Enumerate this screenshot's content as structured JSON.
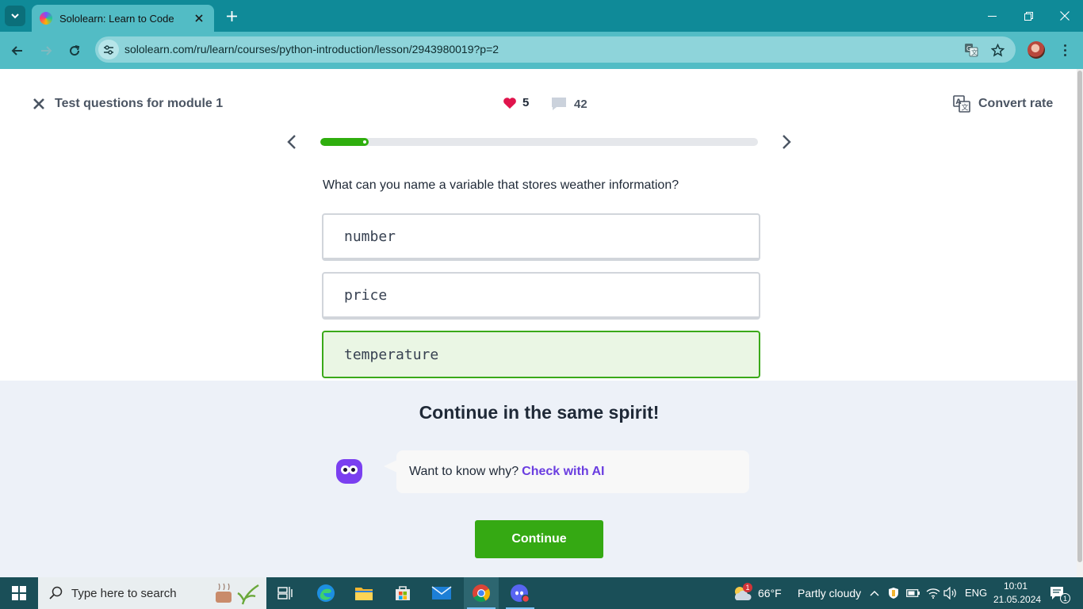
{
  "browser": {
    "tab_title": "Sololearn: Learn to Code",
    "url": "sololearn.com/ru/learn/courses/python-introduction/lesson/2943980019?p=2"
  },
  "lesson": {
    "title": "Test questions for module 1",
    "hearts": "5",
    "comments": "42",
    "convert_label": "Convert rate",
    "progress": 0.11
  },
  "quiz": {
    "question": "What can you name a variable that stores weather information?",
    "options": [
      {
        "text": "number",
        "state": "default"
      },
      {
        "text": "price",
        "state": "default"
      },
      {
        "text": "temperature",
        "state": "correct"
      }
    ]
  },
  "feedback": {
    "title": "Continue in the same spirit!",
    "ai_prompt": "Want to know why?",
    "ai_link": "Check with AI",
    "continue_label": "Continue"
  },
  "taskbar": {
    "search_placeholder": "Type here to search",
    "weather_temp": "66°F",
    "weather_desc": "Partly cloudy",
    "weather_badge": "1",
    "language": "ENG",
    "time": "10:01",
    "date": "21.05.2024",
    "notification_count": "1"
  },
  "colors": {
    "tab_strip": "#0f8a98",
    "toolbar": "#52bcc5",
    "accent_green": "#35a913",
    "ai_purple": "#6a3de0",
    "heart_red": "#e0144c"
  }
}
